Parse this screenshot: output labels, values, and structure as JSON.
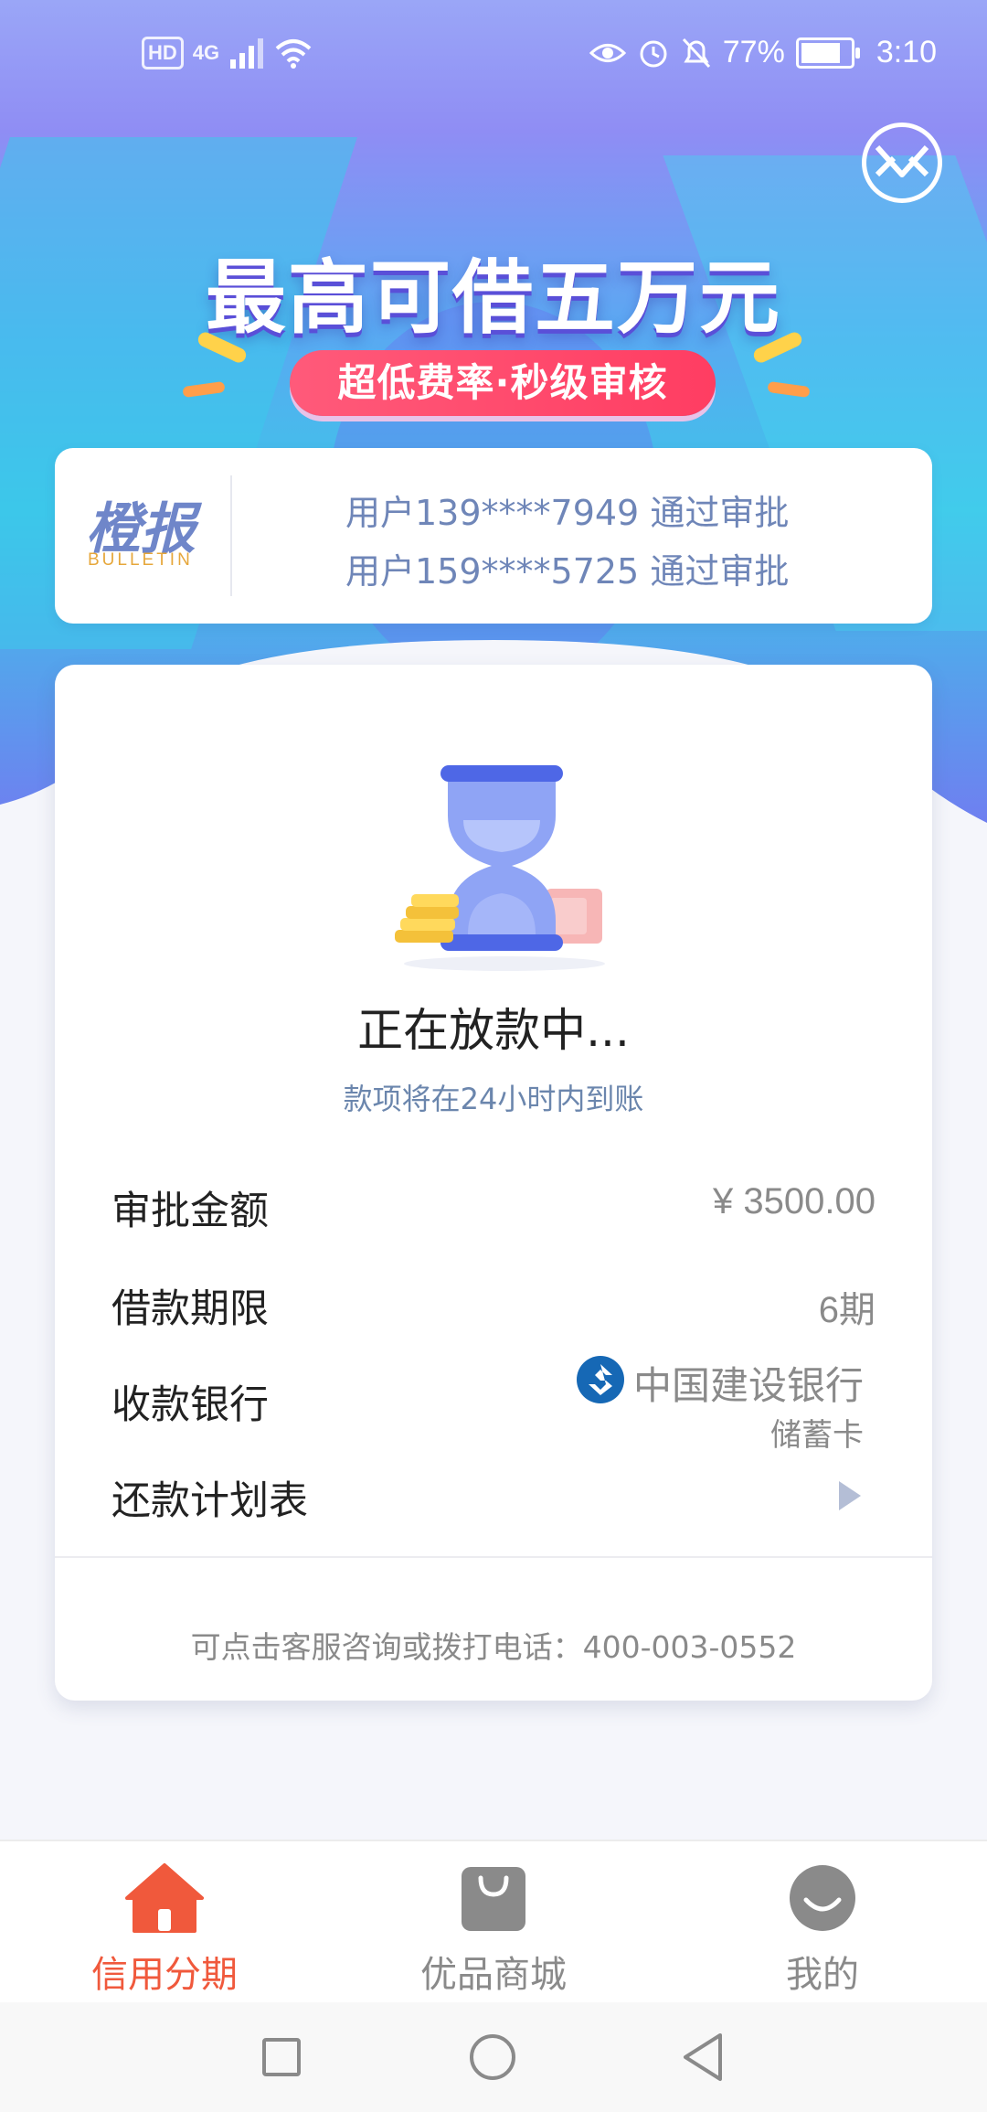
{
  "status_bar": {
    "left_chips": [
      "HD",
      "4G"
    ],
    "battery_percent": "77%",
    "time": "3:10"
  },
  "hero": {
    "headline": "最高可借五万元",
    "subtitle": "超低费率·秒级审核"
  },
  "bulletin": {
    "brand_cn": "橙报",
    "brand_en": "BULLETIN",
    "lines": [
      "用户139****7949 通过审批",
      "用户159****5725 通过审批"
    ]
  },
  "loan_status": {
    "title": "正在放款中...",
    "subtitle": "款项将在24小时内到账",
    "rows": {
      "amount": {
        "label": "审批金额",
        "value": "¥ 3500.00"
      },
      "term": {
        "label": "借款期限",
        "value": "6期"
      },
      "bank": {
        "label": "收款银行",
        "name": "中国建设银行",
        "type": "储蓄卡"
      },
      "schedule": {
        "label": "还款计划表"
      }
    },
    "hotline": "可点击客服咨询或拨打电话：400-003-0552"
  },
  "tabbar": {
    "tabs": [
      {
        "label": "信用分期",
        "icon": "home-icon",
        "active": true
      },
      {
        "label": "优品商城",
        "icon": "shopping-bag-icon",
        "active": false
      },
      {
        "label": "我的",
        "icon": "profile-icon",
        "active": false
      }
    ]
  },
  "colors": {
    "accent": "#f0593c",
    "inactive_tab": "#8a8a8a",
    "subpill": "#ff4d6d",
    "bulletin_text": "#6f86b8"
  }
}
